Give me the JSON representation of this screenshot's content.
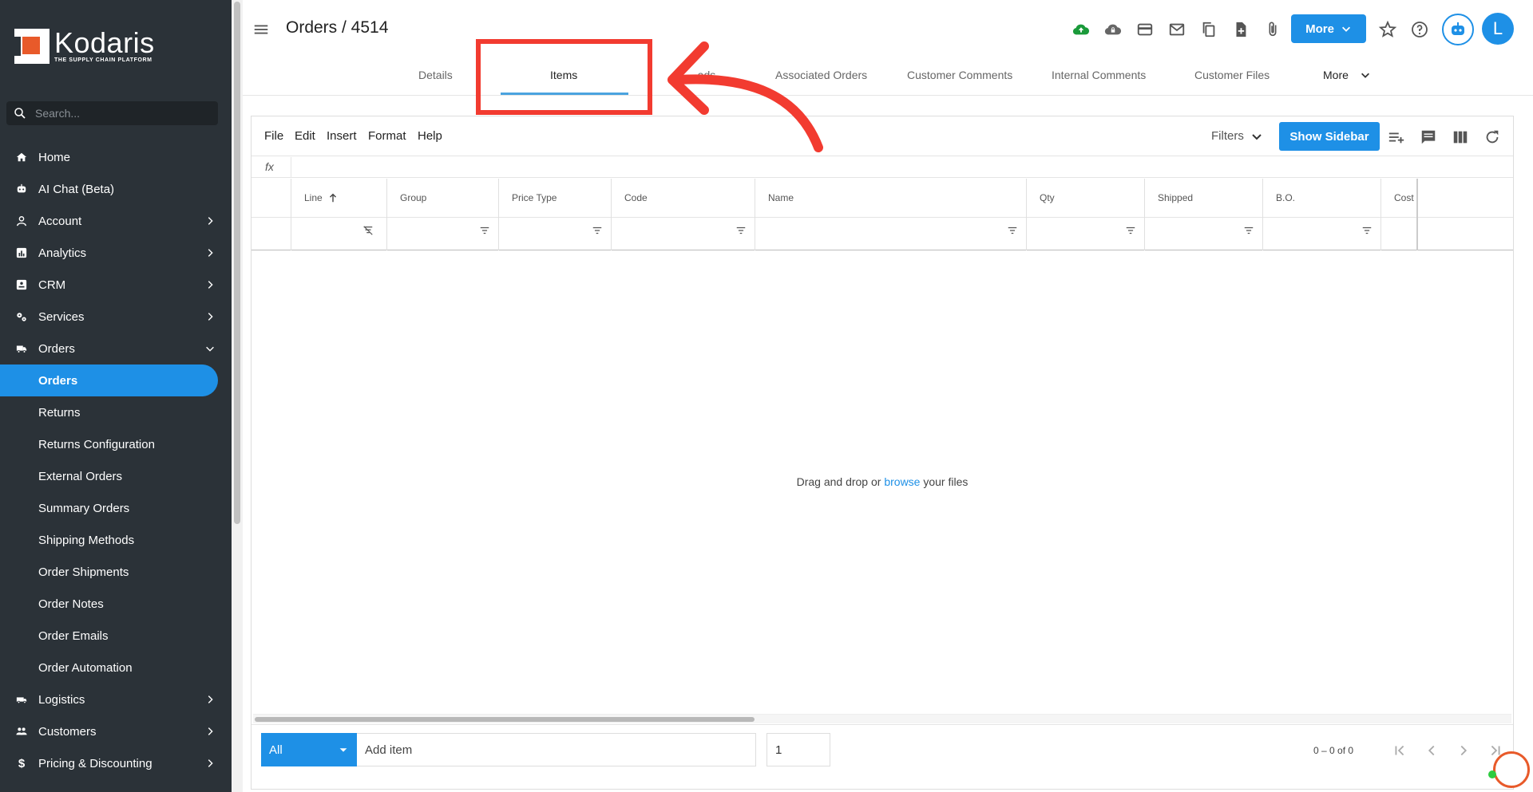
{
  "brand": {
    "name": "Kodaris",
    "tagline": "THE SUPPLY CHAIN PLATFORM"
  },
  "search": {
    "placeholder": "Search..."
  },
  "sidebar": {
    "items": [
      {
        "label": "Home",
        "icon": "home-icon"
      },
      {
        "label": "AI Chat (Beta)",
        "icon": "robot-icon"
      },
      {
        "label": "Account",
        "icon": "user-icon"
      },
      {
        "label": "Analytics",
        "icon": "analytics-icon"
      },
      {
        "label": "CRM",
        "icon": "contact-card-icon"
      },
      {
        "label": "Services",
        "icon": "gears-icon"
      },
      {
        "label": "Orders",
        "icon": "truck-icon"
      }
    ],
    "orders_sub": [
      {
        "label": "Orders"
      },
      {
        "label": "Returns"
      },
      {
        "label": "Returns Configuration"
      },
      {
        "label": "External Orders"
      },
      {
        "label": "Summary Orders"
      },
      {
        "label": "Shipping Methods"
      },
      {
        "label": "Order Shipments"
      },
      {
        "label": "Order Notes"
      },
      {
        "label": "Order Emails"
      },
      {
        "label": "Order Automation"
      }
    ],
    "items_after": [
      {
        "label": "Logistics",
        "icon": "shipping-icon"
      },
      {
        "label": "Customers",
        "icon": "people-icon"
      },
      {
        "label": "Pricing & Discounting",
        "icon": "dollar-icon"
      }
    ]
  },
  "header": {
    "title": "Orders / 4514",
    "more_label": "More",
    "avatar_letter": "L"
  },
  "tabs": [
    {
      "label": "Details"
    },
    {
      "label": "Items"
    },
    {
      "label": "...ads"
    },
    {
      "label": "Associated Orders"
    },
    {
      "label": "Customer Comments"
    },
    {
      "label": "Internal Comments"
    },
    {
      "label": "Customer Files"
    },
    {
      "label": "More"
    }
  ],
  "menubar": [
    "File",
    "Edit",
    "Insert",
    "Format",
    "Help"
  ],
  "grid_toolbar": {
    "filters_label": "Filters",
    "show_sidebar_label": "Show Sidebar"
  },
  "formula_bar": {
    "fx_label": "fx"
  },
  "columns": [
    "Line",
    "Group",
    "Price Type",
    "Code",
    "Name",
    "Qty",
    "Shipped",
    "B.O.",
    "Cost"
  ],
  "empty_state": {
    "prefix": "Drag and drop or ",
    "link": "browse",
    "suffix": " your files"
  },
  "footer": {
    "select_value": "All",
    "add_item_placeholder": "Add item",
    "qty_value": "1",
    "pager_text": "0 – 0 of 0"
  },
  "colors": {
    "accent": "#1e90e6",
    "sidebar_bg": "#2b3238",
    "annotation": "#f23b30"
  }
}
